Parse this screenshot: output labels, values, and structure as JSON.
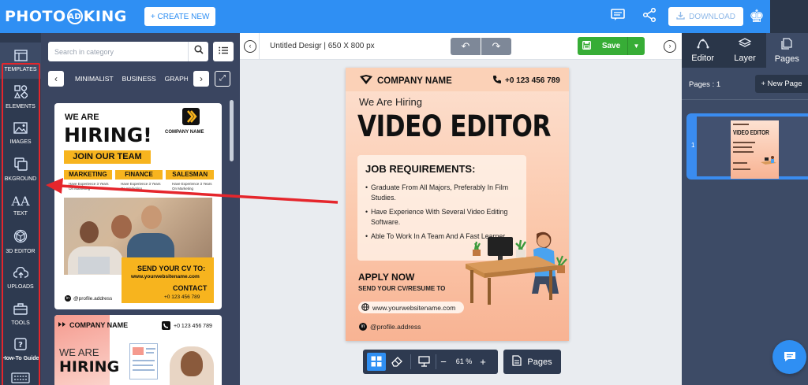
{
  "topbar": {
    "logo_left": "PHOTO",
    "logo_mid": "AD",
    "logo_right": "KING",
    "create_label": "+ CREATE NEW",
    "download_label": "DOWNLOAD",
    "accent": "#2f8ff3"
  },
  "rail": {
    "items": [
      {
        "label": "TEMPLATES",
        "icon": "templates-icon"
      },
      {
        "label": "ELEMENTS",
        "icon": "elements-icon"
      },
      {
        "label": "IMAGES",
        "icon": "images-icon"
      },
      {
        "label": "BKGROUND",
        "icon": "background-icon"
      },
      {
        "label": "TEXT",
        "icon": "text-icon"
      },
      {
        "label": "3D EDITOR",
        "icon": "3d-editor-icon"
      },
      {
        "label": "UPLOADS",
        "icon": "uploads-icon"
      },
      {
        "label": "TOOLS",
        "icon": "tools-icon"
      },
      {
        "label": "How-To Guide",
        "icon": "help-icon"
      }
    ],
    "highlight_color": "#e5262c"
  },
  "panel": {
    "search_placeholder": "Search in category",
    "categories": [
      "MINIMALIST",
      "BUSINESS",
      "GRAPHI"
    ]
  },
  "template1": {
    "we_are": "WE ARE",
    "hiring": "HIRING!",
    "company": "COMPANY NAME",
    "join": "JOIN OUR TEAM",
    "tags": [
      "MARKETING",
      "FINANCE",
      "SALESMAN"
    ],
    "small": "Have Experience 3 Years On Marketing",
    "send_cv": "SEND YOUR CV TO:",
    "url": "www.yourwebsitename.com",
    "contact": "CONTACT",
    "phone": "+0 123 456 789",
    "profile": "@profile.address"
  },
  "template2": {
    "company": "COMPANY NAME",
    "phone": "+0 123 456 789",
    "we_are": "WE ARE",
    "hiring": "HIRING"
  },
  "canvas": {
    "title": "Untitled Desigr | 650 X 800 px",
    "save_label": "Save",
    "zoom": "61 %",
    "pages_label": "Pages"
  },
  "poster": {
    "company": "COMPANY NAME",
    "phone": "+0 123 456 789",
    "we_are": "We Are Hiring",
    "title": "VIDEO EDITOR",
    "req_title": "JOB REQUIREMENTS:",
    "bullets": [
      "Graduate From All Majors, Preferably In Film Studies.",
      "Have Experience With Several Video Editing Software.",
      "Able To Work In A Team And A Fast Learner."
    ],
    "apply": "APPLY NOW",
    "send": "SEND YOUR CV/RESUME TO",
    "url": "www.yourwebsitename.com",
    "profile": "@profile.address"
  },
  "right": {
    "tabs": [
      {
        "label": "Editor",
        "icon": "editor-icon"
      },
      {
        "label": "Layer",
        "icon": "layer-icon"
      },
      {
        "label": "Pages",
        "icon": "pages-icon"
      }
    ],
    "pages_count": "Pages : 1",
    "new_page": "+ New Page",
    "page_number": "1",
    "mini_title": "VIDEO EDITOR"
  }
}
